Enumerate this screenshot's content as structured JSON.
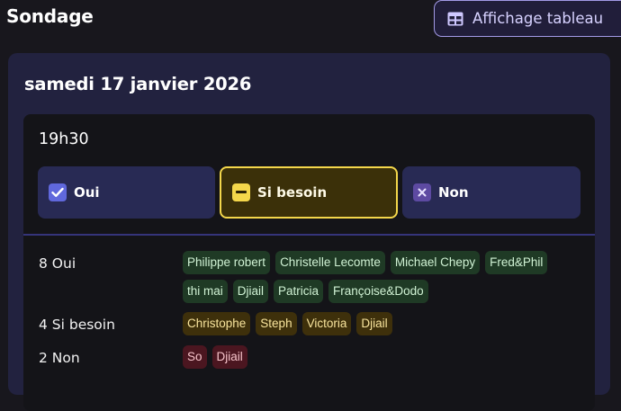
{
  "page": {
    "title": "Sondage"
  },
  "header": {
    "table_view_label": "Affichage tableau"
  },
  "poll": {
    "date": "samedi 17 janvier 2026",
    "slot": {
      "time": "19h30",
      "options": [
        {
          "label": "Oui",
          "icon": "check-icon",
          "color": "#6068dc"
        },
        {
          "label": "Si besoin",
          "icon": "minus-icon",
          "color": "#f4d74b",
          "selected": true
        },
        {
          "label": "Non",
          "icon": "cross-icon",
          "color": "#5d4aa2"
        }
      ],
      "results": {
        "oui": {
          "label": "8 Oui",
          "names": [
            "Philippe robert",
            "Christelle Lecomte",
            "Michael Chepy",
            "Fred&Phil",
            "thi mai",
            "Djiail",
            "Patricia",
            "Françoise&Dodo"
          ]
        },
        "si_besoin": {
          "label": "4 Si besoin",
          "names": [
            "Christophe",
            "Steph",
            "Victoria",
            "Djiail"
          ]
        },
        "non": {
          "label": "2 Non",
          "names": [
            "So",
            "Djiail"
          ]
        }
      }
    }
  }
}
